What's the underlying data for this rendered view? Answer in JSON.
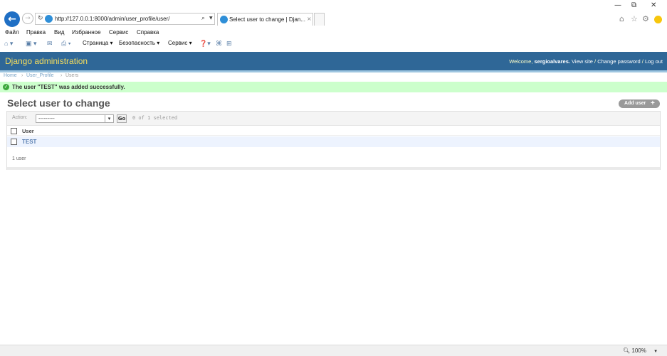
{
  "browser": {
    "url": "http://127.0.0.1:8000/admin/user_profile/user/",
    "tab_title": "Select user to change | Djan...",
    "tab_close": "×",
    "window_controls": {
      "minimize": "—",
      "restore": "⧉",
      "close": "✕"
    },
    "menu": [
      "Файл",
      "Правка",
      "Вид",
      "Избранное",
      "Сервис",
      "Справка"
    ],
    "commands": {
      "page": "Страница ▾",
      "security": "Безопасность ▾",
      "service": "Сервис ▾"
    },
    "zoom": "100%"
  },
  "header": {
    "title": "Django administration",
    "welcome": "Welcome,",
    "username": "sergioalvares.",
    "view_site": "View site",
    "change_password": "Change password",
    "log_out": "Log out",
    "separator": "/"
  },
  "breadcrumbs": {
    "home": "Home",
    "app": "User_Profile",
    "current": "Users",
    "separator": "›"
  },
  "message": {
    "text": "The user \"TEST\" was added successfully.",
    "color": "#ccffcc"
  },
  "page": {
    "title": "Select user to change",
    "add_button": "Add user"
  },
  "actions": {
    "label": "Action:",
    "selected_value": "---------",
    "go_label": "Go",
    "selection_count": "0 of 1 selected"
  },
  "table": {
    "column_header": "User",
    "rows": [
      {
        "name": "TEST"
      }
    ]
  },
  "paginator": "1 user",
  "colors": {
    "header_bg": "#2f6797",
    "title": "#f5dd5d",
    "link": "#5b80b2",
    "row_bg": "#edf3fe"
  }
}
